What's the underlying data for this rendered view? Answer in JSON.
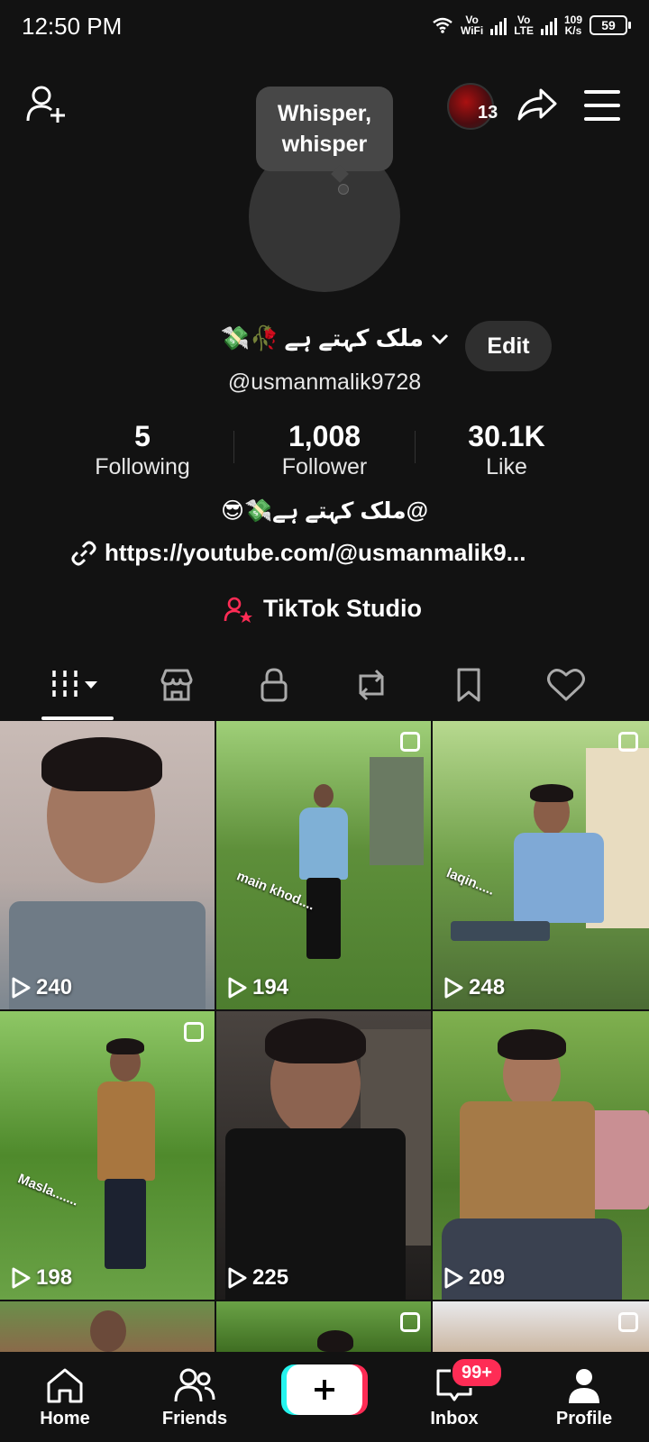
{
  "status_bar": {
    "time": "12:50 PM",
    "wifi_label_top": "Vo",
    "wifi_label_bottom": "WiFi",
    "lte_label_top": "Vo",
    "lte_label_bottom": "LTE",
    "speed_top": "109",
    "speed_bottom": "K/s",
    "battery": "59"
  },
  "header": {
    "story_count": "13",
    "note_bubble": "Whisper, whisper"
  },
  "profile": {
    "display_name": "ملک کہتے ہے",
    "name_emoji": "💸🥀",
    "edit_label": "Edit",
    "handle": "@usmanmalik9728",
    "stats": [
      {
        "value": "5",
        "label": "Following"
      },
      {
        "value": "1,008",
        "label": "Follower"
      },
      {
        "value": "30.1K",
        "label": "Like"
      }
    ],
    "bio": "@ملک کہتے ہے💸😎",
    "link": "https://youtube.com/@usmanmalik9...",
    "studio_label": "TikTok Studio"
  },
  "tabs": [
    {
      "icon": "videos-grid-icon"
    },
    {
      "icon": "shop-icon"
    },
    {
      "icon": "lock-icon"
    },
    {
      "icon": "repost-icon"
    },
    {
      "icon": "bookmark-icon"
    },
    {
      "icon": "heart-icon"
    }
  ],
  "videos": [
    {
      "views": "240",
      "caption": ""
    },
    {
      "views": "194",
      "caption": "main khod...."
    },
    {
      "views": "248",
      "caption": "laqin....."
    },
    {
      "views": "198",
      "caption": "Masla......."
    },
    {
      "views": "225",
      "caption": ""
    },
    {
      "views": "209",
      "caption": ""
    }
  ],
  "bottom_nav": {
    "home": "Home",
    "friends": "Friends",
    "inbox": "Inbox",
    "inbox_badge": "99+",
    "profile": "Profile"
  },
  "colors": {
    "background": "#121212",
    "accent_red": "#fe2c55",
    "accent_cyan": "#25f4ee"
  }
}
